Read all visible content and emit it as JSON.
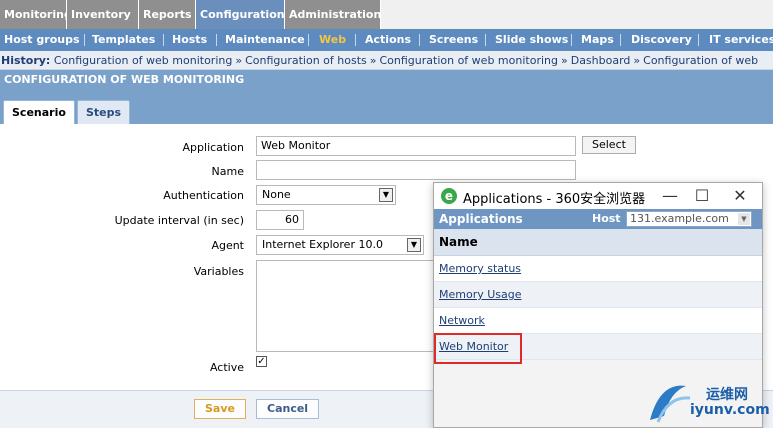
{
  "topmenu": {
    "tabs": [
      {
        "label": "Monitoring"
      },
      {
        "label": "Inventory"
      },
      {
        "label": "Reports"
      },
      {
        "label": "Configuration",
        "active": true
      },
      {
        "label": "Administration"
      }
    ]
  },
  "submenu": {
    "items": [
      "Host groups",
      "Templates",
      "Hosts",
      "Maintenance",
      "Web",
      "Actions",
      "Screens",
      "Slide shows",
      "Maps",
      "Discovery",
      "IT services"
    ],
    "active": "Web"
  },
  "history": {
    "label": "History:",
    "items": [
      "Configuration of web monitoring",
      "Configuration of hosts",
      "Configuration of web monitoring",
      "Dashboard",
      "Configuration of web"
    ]
  },
  "page_title": "CONFIGURATION OF WEB MONITORING",
  "tabs": {
    "scenario": "Scenario",
    "steps": "Steps"
  },
  "form": {
    "application_label": "Application",
    "application_value": "Web Monitor",
    "select_button": "Select",
    "name_label": "Name",
    "name_value": "",
    "authentication_label": "Authentication",
    "authentication_value": "None",
    "update_interval_label": "Update interval (in sec)",
    "update_interval_value": "60",
    "agent_label": "Agent",
    "agent_value": "Internet Explorer 10.0",
    "variables_label": "Variables",
    "active_label": "Active",
    "active_checked": true,
    "save_button": "Save",
    "cancel_button": "Cancel"
  },
  "popup": {
    "window_title": "Applications - 360安全浏览器",
    "header": "Applications",
    "host_label": "Host",
    "host_value": "131.example.com",
    "column_name": "Name",
    "rows": [
      "Memory status",
      "Memory Usage",
      "Network",
      "Web Monitor"
    ],
    "highlighted": "Web Monitor"
  },
  "watermark": {
    "line1": "运维网",
    "line2": "iyunv.com"
  },
  "colors": {
    "accent": "#6b8fbd",
    "submenu": "#5e8bbf",
    "active_web": "#f5c542",
    "highlight": "#e02a2a"
  }
}
